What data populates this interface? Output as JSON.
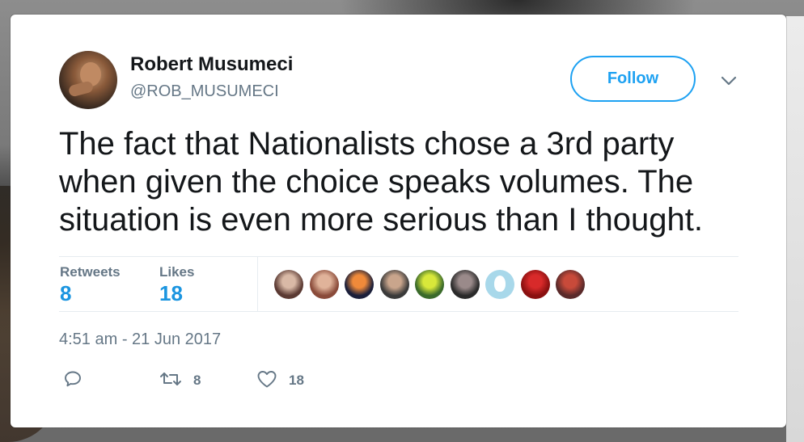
{
  "tweet": {
    "author_name": "Robert Musumeci",
    "author_handle": "@ROB_MUSUMECI",
    "follow_label": "Follow",
    "text": "The fact that Nationalists chose a 3rd party when given the choice speaks volumes. The situation is even more serious than I thought.",
    "timestamp": "4:51 am - 21 Jun 2017"
  },
  "stats": {
    "retweets_label": "Retweets",
    "retweets_count": "8",
    "likes_label": "Likes",
    "likes_count": "18"
  },
  "likers": [
    {
      "icon": "woman-avatar",
      "colors": [
        "#5b3a33",
        "#d9b9a6"
      ]
    },
    {
      "icon": "man-glasses-avatar",
      "colors": [
        "#8a4b3a",
        "#e0b39a"
      ]
    },
    {
      "icon": "sunset-avatar",
      "colors": [
        "#1b1f3a",
        "#f08a3a"
      ]
    },
    {
      "icon": "man-bald-avatar",
      "colors": [
        "#3a3a3a",
        "#c9a58c"
      ]
    },
    {
      "icon": "hivis-avatar",
      "colors": [
        "#3a6a2a",
        "#d8e83a"
      ]
    },
    {
      "icon": "man-dark-avatar",
      "colors": [
        "#2a2a2a",
        "#9a8a8a"
      ]
    },
    {
      "icon": "default-egg-avatar",
      "colors": [
        "#a8d8ea",
        "#ffffff"
      ]
    },
    {
      "icon": "football-jersey-avatar",
      "colors": [
        "#8a1010",
        "#d82a2a"
      ]
    },
    {
      "icon": "stadium-avatar",
      "colors": [
        "#5a2a2a",
        "#c84a3a"
      ]
    }
  ],
  "actions": {
    "reply_icon": "reply-icon",
    "retweet_icon": "retweet-icon",
    "retweet_count": "8",
    "like_icon": "heart-icon",
    "like_count": "18"
  },
  "colors": {
    "accent": "#1da1f2",
    "stat_value": "#1b95e0",
    "muted": "#657786",
    "text": "#14171a"
  }
}
